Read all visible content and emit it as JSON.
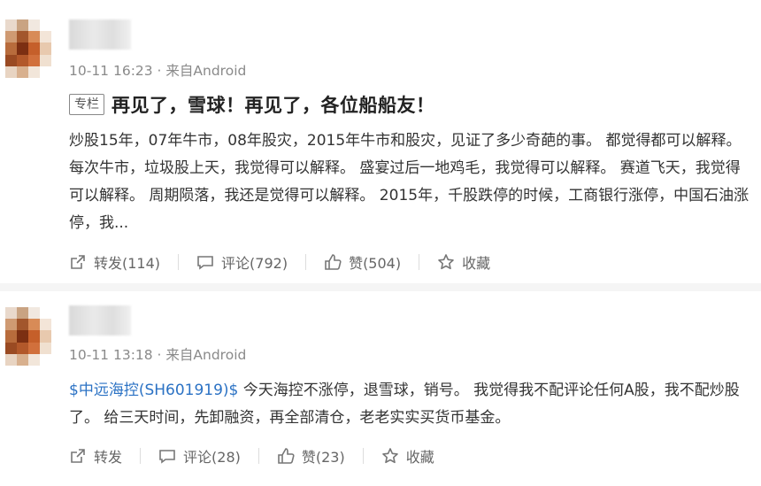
{
  "posts": [
    {
      "meta": "10-11 16:23 · 来自Android",
      "badge": "专栏",
      "title": "再见了，雪球！再见了，各位船船友！",
      "body": "炒股15年，07年牛市，08年股灾，2015年牛市和股灾，见证了多少奇葩的事。 都觉得都可以解释。 每次牛市，垃圾股上天，我觉得可以解释。 盛宴过后一地鸡毛，我觉得可以解释。 赛道飞天，我觉得可以解释。 周期陨落，我还是觉得可以解释。 2015年，千股跌停的时候，工商银行涨停，中国石油涨停，我...",
      "actions": {
        "repost": "转发(114)",
        "comment": "评论(792)",
        "like": "赞(504)",
        "fav": "收藏"
      }
    },
    {
      "meta": "10-11 13:18 · 来自Android",
      "stock": "$中远海控(SH601919)$",
      "body": " 今天海控不涨停，退雪球，销号。 我觉得我不配评论任何A股，我不配炒股了。 给三天时间，先卸融资，再全部清仓，老老实实买货币基金。",
      "actions": {
        "repost": "转发",
        "comment": "评论(28)",
        "like": "赞(23)",
        "fav": "收藏"
      }
    }
  ],
  "colors": {
    "link": "#2b72c4",
    "meta": "#8a8a8a"
  }
}
